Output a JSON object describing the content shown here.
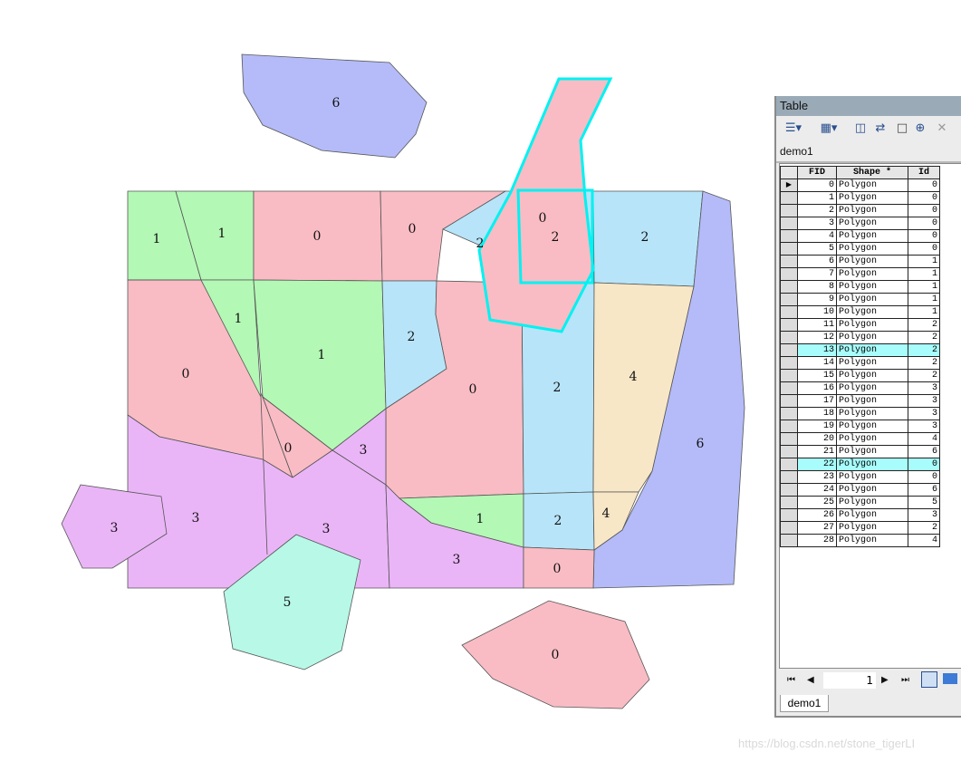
{
  "map": {
    "feature_labels": [
      "6",
      "1",
      "1",
      "0",
      "0",
      "2",
      "0",
      "2",
      "2",
      "1",
      "1",
      "0",
      "2",
      "0",
      "2",
      "4",
      "0",
      "3",
      "3",
      "6",
      "3",
      "3",
      "3",
      "5",
      "1",
      "2",
      "4",
      "3",
      "0",
      "0"
    ],
    "colors": {
      "pink": "#f9bcc4",
      "green": "#b3f8b5",
      "lightblue": "#b7e4f8",
      "violet": "#eab5f7",
      "periwinkle": "#b4bbf8",
      "mint": "#b7f8e7",
      "beige": "#f8e7c7",
      "selection": "#00f2f2",
      "outline": "#555555"
    }
  },
  "table_window": {
    "title": "Table",
    "tab_name": "demo1",
    "columns": [
      "FID",
      "Shape *",
      "Id"
    ],
    "rows": [
      [
        "0",
        "Polygon",
        "0"
      ],
      [
        "1",
        "Polygon",
        "0"
      ],
      [
        "2",
        "Polygon",
        "0"
      ],
      [
        "3",
        "Polygon",
        "0"
      ],
      [
        "4",
        "Polygon",
        "0"
      ],
      [
        "5",
        "Polygon",
        "0"
      ],
      [
        "6",
        "Polygon",
        "1"
      ],
      [
        "7",
        "Polygon",
        "1"
      ],
      [
        "8",
        "Polygon",
        "1"
      ],
      [
        "9",
        "Polygon",
        "1"
      ],
      [
        "10",
        "Polygon",
        "1"
      ],
      [
        "11",
        "Polygon",
        "2"
      ],
      [
        "12",
        "Polygon",
        "2"
      ],
      [
        "13",
        "Polygon",
        "2"
      ],
      [
        "14",
        "Polygon",
        "2"
      ],
      [
        "15",
        "Polygon",
        "2"
      ],
      [
        "16",
        "Polygon",
        "3"
      ],
      [
        "17",
        "Polygon",
        "3"
      ],
      [
        "18",
        "Polygon",
        "3"
      ],
      [
        "19",
        "Polygon",
        "3"
      ],
      [
        "20",
        "Polygon",
        "4"
      ],
      [
        "21",
        "Polygon",
        "6"
      ],
      [
        "22",
        "Polygon",
        "0"
      ],
      [
        "23",
        "Polygon",
        "0"
      ],
      [
        "24",
        "Polygon",
        "6"
      ],
      [
        "25",
        "Polygon",
        "5"
      ],
      [
        "26",
        "Polygon",
        "3"
      ],
      [
        "27",
        "Polygon",
        "2"
      ],
      [
        "28",
        "Polygon",
        "4"
      ]
    ],
    "selected_fids": [
      "13",
      "22"
    ],
    "current_record": "1",
    "bottom_tab": "demo1",
    "toolbar_icons": [
      "table-options-icon",
      "related-tables-icon",
      "select-by-attributes-icon",
      "switch-selection-icon",
      "clear-selection-icon",
      "zoom-to-selected-icon",
      "delete-selected-icon"
    ]
  },
  "watermark": "https://blog.csdn.net/stone_tigerLI"
}
